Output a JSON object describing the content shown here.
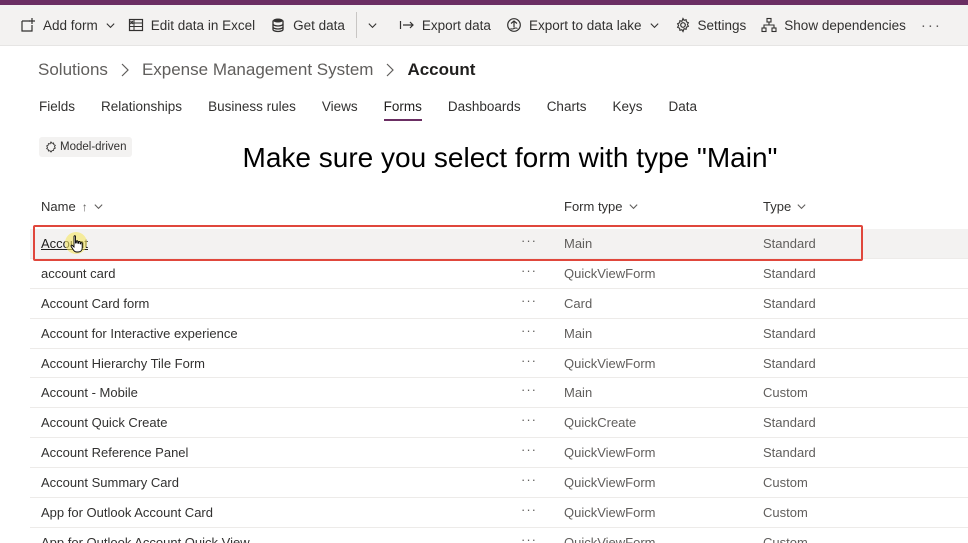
{
  "command_bar": {
    "add_form": "Add form",
    "edit_excel": "Edit data in Excel",
    "get_data": "Get data",
    "export_data": "Export data",
    "export_lake": "Export to data lake",
    "settings": "Settings",
    "show_dependencies": "Show dependencies",
    "more": "···"
  },
  "breadcrumb": {
    "root": "Solutions",
    "solution": "Expense Management System",
    "current": "Account"
  },
  "tabs": [
    {
      "label": "Fields"
    },
    {
      "label": "Relationships"
    },
    {
      "label": "Business rules"
    },
    {
      "label": "Views"
    },
    {
      "label": "Forms",
      "active": true
    },
    {
      "label": "Dashboards"
    },
    {
      "label": "Charts"
    },
    {
      "label": "Keys"
    },
    {
      "label": "Data"
    }
  ],
  "filter_chip": "Model-driven",
  "overlay_text": "Make sure you select form with type \"Main\"",
  "columns": {
    "name": "Name",
    "name_sort": "↑",
    "form_type": "Form type",
    "type": "Type"
  },
  "rows": [
    {
      "name": "Account",
      "form_type": "Main",
      "type": "Standard",
      "selected": true
    },
    {
      "name": "account card",
      "form_type": "QuickViewForm",
      "type": "Standard"
    },
    {
      "name": "Account Card form",
      "form_type": "Card",
      "type": "Standard"
    },
    {
      "name": "Account for Interactive experience",
      "form_type": "Main",
      "type": "Standard"
    },
    {
      "name": "Account Hierarchy Tile Form",
      "form_type": "QuickViewForm",
      "type": "Standard"
    },
    {
      "name": "Account - Mobile",
      "form_type": "Main",
      "type": "Custom"
    },
    {
      "name": "Account Quick Create",
      "form_type": "QuickCreate",
      "type": "Standard"
    },
    {
      "name": "Account Reference Panel",
      "form_type": "QuickViewForm",
      "type": "Standard"
    },
    {
      "name": "Account Summary Card",
      "form_type": "QuickViewForm",
      "type": "Custom"
    },
    {
      "name": "App for Outlook Account Card",
      "form_type": "QuickViewForm",
      "type": "Custom"
    },
    {
      "name": "App for Outlook Account Quick View",
      "form_type": "QuickViewForm",
      "type": "Custom"
    }
  ],
  "row_actions_label": "···",
  "colors": {
    "accent": "#6b2e63",
    "highlight_box": "#e0473c",
    "cursor_glow": "#f5e663"
  },
  "icons": {
    "add_form": "new-form-icon",
    "edit_excel": "excel-icon",
    "get_data": "database-icon",
    "export_data": "export-arrow-icon",
    "export_lake": "data-lake-icon",
    "settings": "gear-icon",
    "show_dependencies": "hierarchy-icon",
    "chip": "model-driven-icon"
  }
}
